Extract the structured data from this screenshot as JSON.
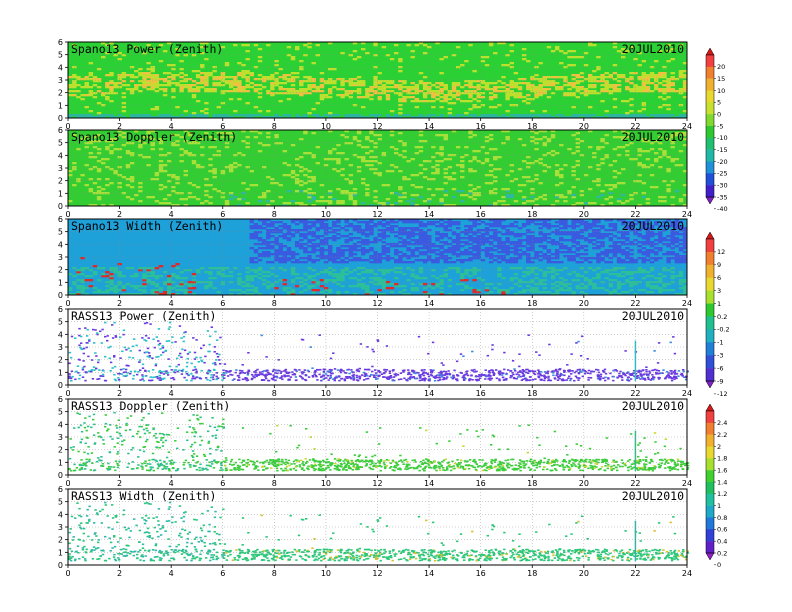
{
  "figure": {
    "date_label": "20JUL2010"
  },
  "chart_data": [
    {
      "type": "heatmap",
      "title": "Spano13 Power (Zenith)",
      "date": "20JUL2010",
      "xlim": [
        0,
        24
      ],
      "ylim": [
        0,
        6
      ],
      "xticks": [
        0,
        2,
        4,
        6,
        8,
        10,
        12,
        14,
        16,
        18,
        20,
        22,
        24
      ],
      "yticks": [
        0,
        1,
        2,
        3,
        4,
        5,
        6
      ],
      "grid": true,
      "colorbar": "power",
      "colors": {
        "background": "#2bd034",
        "band": "#bde02e",
        "core": "#f0c040",
        "edge": "#2db5a0"
      }
    },
    {
      "type": "heatmap",
      "title": "Spano13 Doppler (Zenith)",
      "date": "20JUL2010",
      "xlim": [
        0,
        24
      ],
      "ylim": [
        0,
        6
      ],
      "xticks": [
        0,
        2,
        4,
        6,
        8,
        10,
        12,
        14,
        16,
        18,
        20,
        22,
        24
      ],
      "yticks": [
        0,
        1,
        2,
        3,
        4,
        5,
        6
      ],
      "grid": true,
      "colorbar": "power",
      "colors": {
        "background": "#33cc33",
        "streak": "#a8e03a",
        "low": "#30b8a0"
      }
    },
    {
      "type": "heatmap",
      "title": "Spano13 Width (Zenith)",
      "date": "20JUL2010",
      "xlim": [
        0,
        24
      ],
      "ylim": [
        0,
        6
      ],
      "xticks": [
        0,
        2,
        4,
        6,
        8,
        10,
        12,
        14,
        16,
        18,
        20,
        22,
        24
      ],
      "yticks": [
        0,
        1,
        2,
        3,
        4,
        5,
        6
      ],
      "grid": true,
      "colorbar": "width",
      "colors": {
        "background": "#1ea0d8",
        "upper": "#3a5ae0",
        "low": "#2bbf9a",
        "hot": "#e02a2a"
      }
    },
    {
      "type": "scatter",
      "title": "RASS13 Power (Zenith)",
      "date": "20JUL2010",
      "xlim": [
        0,
        24
      ],
      "ylim": [
        0,
        6
      ],
      "xticks": [
        0,
        2,
        4,
        6,
        8,
        10,
        12,
        14,
        16,
        18,
        20,
        22,
        24
      ],
      "yticks": [
        0,
        1,
        2,
        3,
        4,
        5,
        6
      ],
      "grid": true,
      "colorbar": "width",
      "colors": {
        "main": "#6a3ae0",
        "alt": "#3a8ae0",
        "early": "#2cc0c8"
      }
    },
    {
      "type": "scatter",
      "title": "RASS13 Doppler (Zenith)",
      "date": "20JUL2010",
      "xlim": [
        0,
        24
      ],
      "ylim": [
        0,
        6
      ],
      "xticks": [
        0,
        2,
        4,
        6,
        8,
        10,
        12,
        14,
        16,
        18,
        20,
        22,
        24
      ],
      "yticks": [
        0,
        1,
        2,
        3,
        4,
        5,
        6
      ],
      "grid": true,
      "colorbar": "doppler",
      "colors": {
        "main": "#3ccd3c",
        "alt": "#c8d830",
        "early": "#2fc090"
      }
    },
    {
      "type": "scatter",
      "title": "RASS13 Width (Zenith)",
      "date": "20JUL2010",
      "xlim": [
        0,
        24
      ],
      "ylim": [
        0,
        6
      ],
      "xticks": [
        0,
        2,
        4,
        6,
        8,
        10,
        12,
        14,
        16,
        18,
        20,
        22,
        24
      ],
      "yticks": [
        0,
        1,
        2,
        3,
        4,
        5,
        6
      ],
      "grid": true,
      "colorbar": "doppler",
      "colors": {
        "main": "#2cc87a",
        "alt": "#d8c030",
        "early": "#30b8a8"
      }
    }
  ],
  "colorbars": [
    {
      "name": "power",
      "labels": [
        "20",
        "15",
        "10",
        "5",
        "0",
        "-5",
        "-10",
        "-15",
        "-20",
        "-25",
        "-30",
        "-35",
        "-40"
      ],
      "colors": [
        "#d81818",
        "#f04040",
        "#f08030",
        "#f0b030",
        "#e8d830",
        "#c8e030",
        "#80d830",
        "#30c830",
        "#20c070",
        "#20b8a8",
        "#2090d8",
        "#2050d8",
        "#4020c8",
        "#8020c8"
      ]
    },
    {
      "name": "width",
      "labels": [
        "12",
        "9",
        "6",
        "3",
        "1",
        "0.2",
        "-0.2",
        "-1",
        "-3",
        "-6",
        "-9",
        "-12"
      ],
      "colors": [
        "#d81818",
        "#f04040",
        "#f08030",
        "#f0b030",
        "#e8d830",
        "#a8e030",
        "#30c830",
        "#20c090",
        "#20b0c0",
        "#2080d8",
        "#3050d8",
        "#5030d0",
        "#8020c8"
      ]
    },
    {
      "name": "doppler",
      "labels": [
        "2.4",
        "2.2",
        "2",
        "1.8",
        "1.6",
        "1.4",
        "1.2",
        "1",
        "0.8",
        "0.6",
        "0.4",
        "0.2",
        "0"
      ],
      "colors": [
        "#d81818",
        "#f04040",
        "#f08030",
        "#f0b030",
        "#e8d830",
        "#a8e030",
        "#40d030",
        "#20c060",
        "#20c0a0",
        "#20a8c8",
        "#2078d8",
        "#3040d8",
        "#6020c8",
        "#9020c8"
      ]
    }
  ]
}
